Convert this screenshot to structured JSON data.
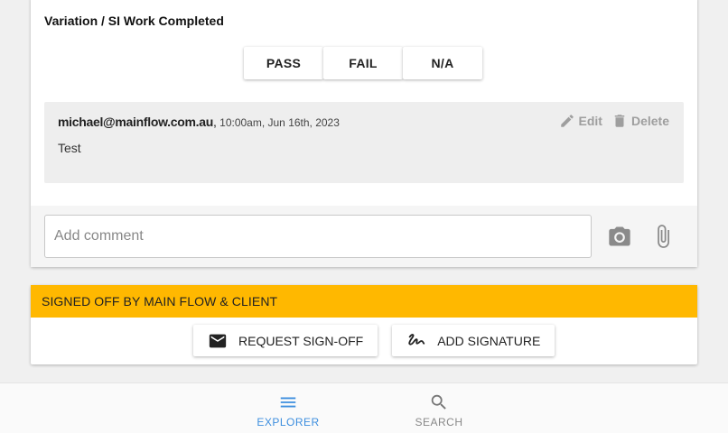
{
  "item": {
    "title": "Variation / SI Work Completed",
    "options": [
      "PASS",
      "FAIL",
      "N/A"
    ]
  },
  "comment": {
    "author": "michael@mainflow.com.au",
    "separator": ",",
    "time": "10:00am, Jun 16th, 2023",
    "text": "Test",
    "edit_label": "Edit",
    "delete_label": "Delete"
  },
  "add_comment": {
    "placeholder": "Add comment",
    "camera_icon": "camera-icon",
    "attach_icon": "paperclip-icon"
  },
  "signoff": {
    "status": "SIGNED OFF BY MAIN FLOW & CLIENT",
    "status_color": "#ffb800",
    "request_label": "REQUEST SIGN-OFF",
    "signature_label": "ADD SIGNATURE"
  },
  "nav": {
    "explorer_label": "EXPLORER",
    "search_label": "SEARCH",
    "active_color": "#3d8ede"
  }
}
